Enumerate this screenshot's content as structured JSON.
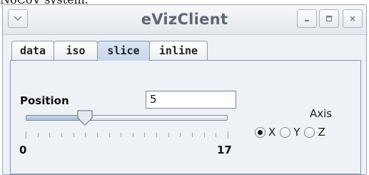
{
  "caption": "NoCoV system.",
  "window": {
    "title": "eVizClient",
    "buttons": {
      "minimize": "–",
      "maximize": "□",
      "close": "×"
    }
  },
  "tabs": [
    {
      "label": "data",
      "active": false
    },
    {
      "label": "iso",
      "active": false
    },
    {
      "label": "slice",
      "active": true
    },
    {
      "label": "inline",
      "active": false
    }
  ],
  "slice": {
    "position_label": "Position",
    "position_value": "5",
    "slider": {
      "min": 0,
      "max": 17,
      "value": 5,
      "min_label": "0",
      "max_label": "17"
    },
    "axis_label": "Axis",
    "axis_options": [
      {
        "label": "X",
        "selected": true
      },
      {
        "label": "Y",
        "selected": false
      },
      {
        "label": "Z",
        "selected": false
      }
    ]
  },
  "colors": {
    "accent": "#c6d6ea",
    "panel_border": "#7f95b1"
  }
}
